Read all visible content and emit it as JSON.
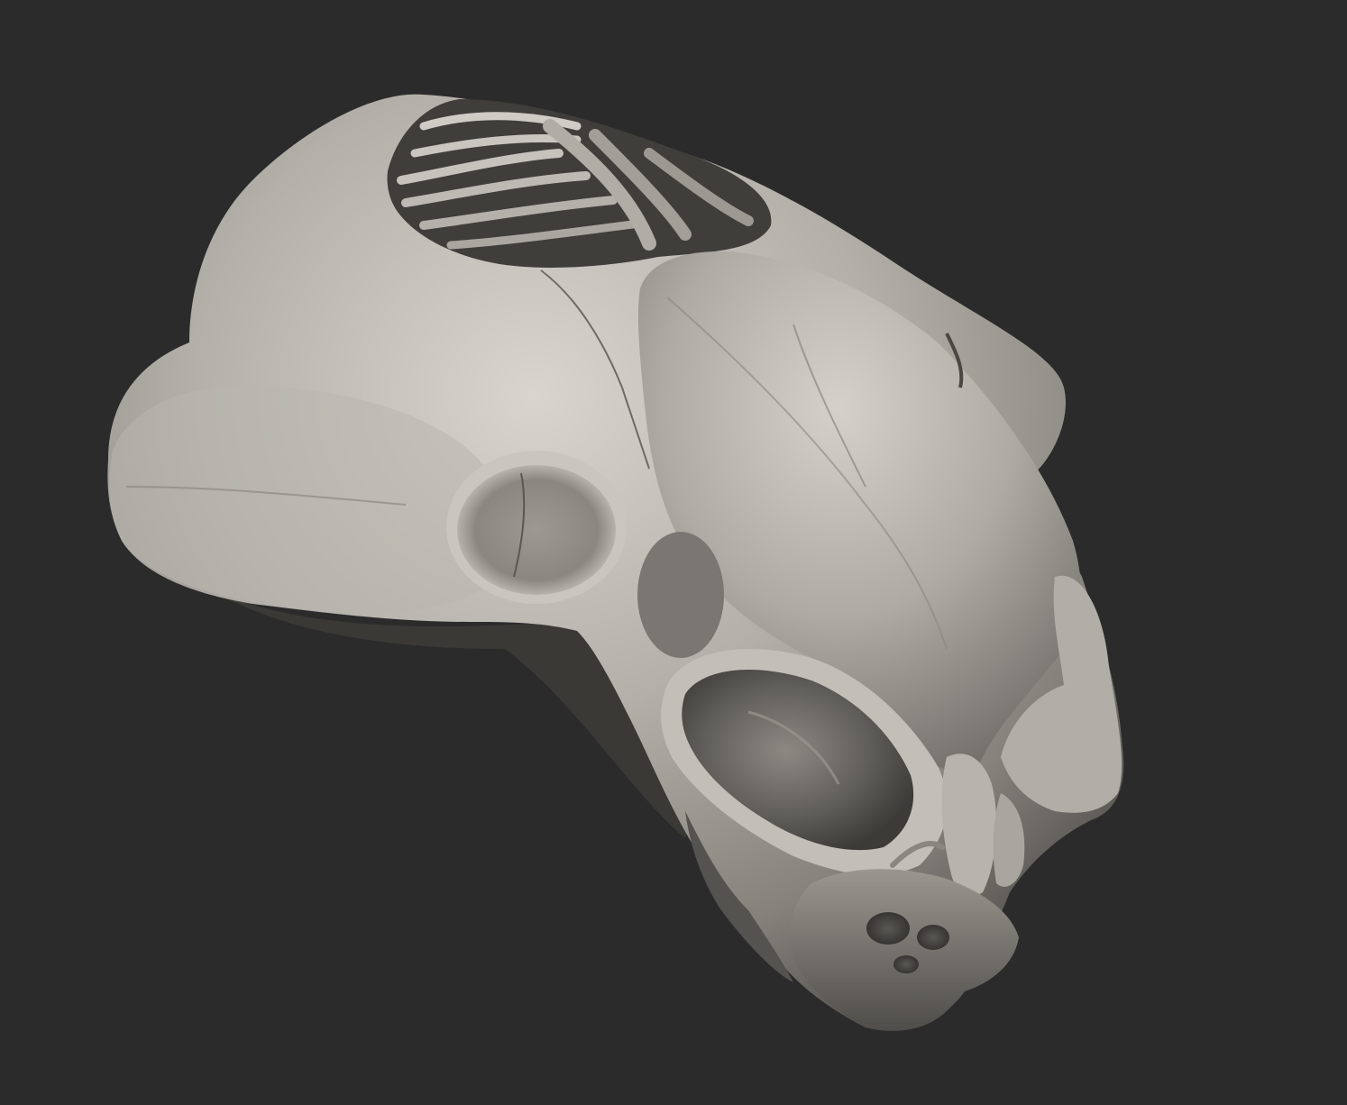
{
  "canvas": {
    "background_color": "#2b2b2b"
  },
  "model": {
    "subject": "sculpted-creature-skull",
    "material_color": "#a8a59e",
    "highlight_color": "#d6d3cc",
    "shadow_color": "#4a4845"
  }
}
